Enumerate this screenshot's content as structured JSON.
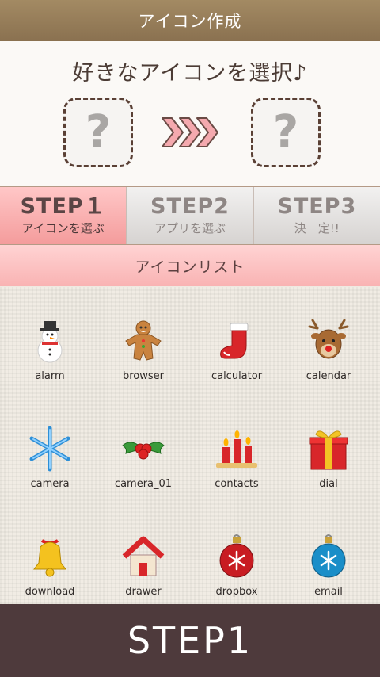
{
  "header": {
    "title": "アイコン作成"
  },
  "hero": {
    "heading": "好きなアイコンを選択♪",
    "placeholder_glyph": "?"
  },
  "steps": [
    {
      "num": "STEP１",
      "sub": "アイコンを選ぶ",
      "active": true
    },
    {
      "num": "STEP2",
      "sub": "アプリを選ぶ",
      "active": false
    },
    {
      "num": "STEP3",
      "sub": "決　定!!",
      "active": false
    }
  ],
  "list_header": "アイコンリスト",
  "icons": [
    {
      "label": "alarm",
      "icon": "snowman-icon"
    },
    {
      "label": "browser",
      "icon": "gingerbread-icon"
    },
    {
      "label": "calculator",
      "icon": "stocking-icon"
    },
    {
      "label": "calendar",
      "icon": "reindeer-icon"
    },
    {
      "label": "camera",
      "icon": "snowflake-icon"
    },
    {
      "label": "camera_01",
      "icon": "holly-icon"
    },
    {
      "label": "contacts",
      "icon": "candles-icon"
    },
    {
      "label": "dial",
      "icon": "gift-icon"
    },
    {
      "label": "download",
      "icon": "bell-icon"
    },
    {
      "label": "drawer",
      "icon": "house-icon"
    },
    {
      "label": "dropbox",
      "icon": "red-ornament-icon"
    },
    {
      "label": "email",
      "icon": "blue-ornament-icon"
    }
  ],
  "footer": {
    "label": "STEP1"
  },
  "colors": {
    "titlebar": "#9a8160",
    "active_step": "#f7a9a9",
    "list_header": "#fbc1c1",
    "footer": "#4e3a3c"
  }
}
